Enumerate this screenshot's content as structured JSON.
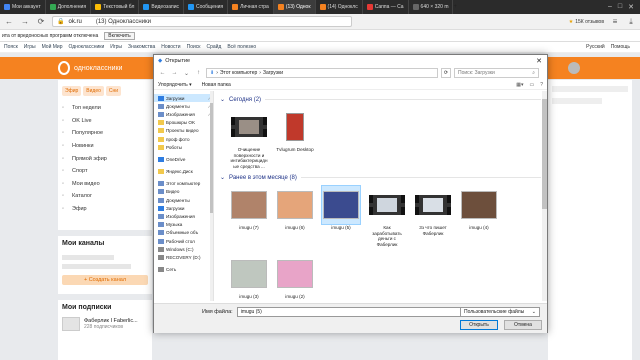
{
  "browser": {
    "tabs": [
      {
        "label": "Мои аккаунт",
        "color": "#4285f4"
      },
      {
        "label": "Дополнения",
        "color": "#34a853"
      },
      {
        "label": "Текстовый бл",
        "color": "#fbbc05"
      },
      {
        "label": "Видеозапис",
        "color": "#2196f3"
      },
      {
        "label": "Сообщения",
        "color": "#2196f3"
      },
      {
        "label": "Личная стра",
        "color": "#f58220"
      },
      {
        "label": "(13) Однок",
        "color": "#f58220",
        "active": true
      },
      {
        "label": "(14) Одноклс",
        "color": "#f58220"
      },
      {
        "label": "Саппа — Ca",
        "color": "#e53935"
      },
      {
        "label": "640 × 320 m",
        "color": "#666666"
      }
    ],
    "url": "ok.ru",
    "page_title": "(13) Одноклассники",
    "rating": "15К отзывов",
    "notification": "ита от вредоносных программ отключена",
    "enable_label": "Включить",
    "bookmarks": [
      "Пояск",
      "Игры",
      "Мой Мир",
      "Одноклассники",
      "Игры",
      "Знакомства",
      "Новости",
      "Поиск",
      "Срайд",
      "Всё полезно"
    ],
    "lang": "Русский",
    "help": "Помощь"
  },
  "ok": {
    "logo_text": "одноклассники",
    "chips": [
      "Эфир",
      "Видео",
      "Сни"
    ],
    "menu": [
      {
        "label": "Топ недели",
        "icon": "top-icon"
      },
      {
        "label": "OK Live",
        "icon": "live-icon"
      },
      {
        "label": "Популярное",
        "icon": "popular-icon"
      },
      {
        "label": "Новинки",
        "icon": "new-icon"
      },
      {
        "label": "Прямой эфир",
        "icon": "broadcast-icon"
      },
      {
        "label": "Спорт",
        "icon": "sport-icon"
      },
      {
        "label": "Мои видео",
        "icon": "video-icon"
      },
      {
        "label": "Каталог",
        "icon": "catalog-icon"
      },
      {
        "label": "Эфир",
        "icon": "stream-icon"
      }
    ],
    "channels_title": "Мои каналы",
    "create_channel": "Создать канал",
    "subscriptions_title": "Мои подписки",
    "subscription": {
      "title": "Фаберлик I Faberlic...",
      "count": "228 подписчиков"
    }
  },
  "dialog": {
    "title": "Открытие",
    "close": "✕",
    "path": [
      "Этот компьютер",
      "Загрузки"
    ],
    "search_placeholder": "Поиск: Загрузки",
    "organize": "Упорядочить ▾",
    "new_folder": "Новая папка",
    "nav": [
      {
        "label": "Загрузки",
        "pin": true,
        "sel": true,
        "color": "#2f7de1"
      },
      {
        "label": "Документы",
        "pin": true,
        "color": "#6b8ec9"
      },
      {
        "label": "Изображения",
        "pin": true,
        "color": "#6b8ec9"
      },
      {
        "label": "Брошюры OK",
        "color": "#f2c94c"
      },
      {
        "label": "Проекты видео",
        "color": "#f2c94c"
      },
      {
        "label": "проф фото",
        "color": "#f2c94c"
      },
      {
        "label": "Роботы",
        "color": "#f2c94c"
      },
      {
        "gap": true
      },
      {
        "label": "OneDrive",
        "color": "#2f7de1"
      },
      {
        "gap": true
      },
      {
        "label": "Яндекс.Диск",
        "color": "#f2c94c"
      },
      {
        "gap": true
      },
      {
        "label": "Этот компьютер",
        "color": "#6b8ec9"
      },
      {
        "label": "Видео",
        "color": "#6b8ec9"
      },
      {
        "label": "Документы",
        "color": "#6b8ec9"
      },
      {
        "label": "Загрузки",
        "color": "#2f7de1"
      },
      {
        "label": "Изображения",
        "color": "#6b8ec9"
      },
      {
        "label": "Музыка",
        "color": "#6b8ec9"
      },
      {
        "label": "Объемные объ",
        "color": "#6b8ec9"
      },
      {
        "label": "Рабочий стол",
        "color": "#6b8ec9"
      },
      {
        "label": "Windows (C:)",
        "color": "#888888"
      },
      {
        "label": "RECOVERY (D:)",
        "color": "#888888"
      },
      {
        "gap": true
      },
      {
        "label": "Сеть",
        "color": "#888888"
      }
    ],
    "groups": [
      {
        "title": "Сегодня (2)",
        "files": [
          {
            "name": "Очищение поверхности и интибактерицидные средства ...",
            "kind": "video",
            "color": "#9a8f86"
          },
          {
            "name": "Tvlugrum Desktop",
            "kind": "doc",
            "color": "#c0392b"
          }
        ]
      },
      {
        "title": "Ранее в этом месяце (8)",
        "files": [
          {
            "name": "imugu (7)",
            "kind": "img",
            "color": "#b0836a"
          },
          {
            "name": "imugu (6)",
            "kind": "img",
            "color": "#e5a57a"
          },
          {
            "name": "imugu (5)",
            "kind": "img",
            "color": "#3b4b8f",
            "sel": true
          },
          {
            "name": "Как заработывать деньги с Фаберлик",
            "kind": "video",
            "color": "#cfd6de"
          },
          {
            "name": "3з что пишет Фаберлик",
            "kind": "video",
            "color": "#d9dfe6"
          },
          {
            "name": "imugu (4)",
            "kind": "img",
            "color": "#6d4f3c"
          },
          {
            "name": "imugu (3)",
            "kind": "img",
            "color": "#bfc7bf"
          },
          {
            "name": "imugu (2)",
            "kind": "img",
            "color": "#e8a4c8"
          }
        ]
      }
    ],
    "filename_label": "Имя файла:",
    "filename_value": "imugu (5)",
    "filetype": "Пользовательские файлы",
    "open": "Открыть",
    "cancel": "Отмена"
  }
}
